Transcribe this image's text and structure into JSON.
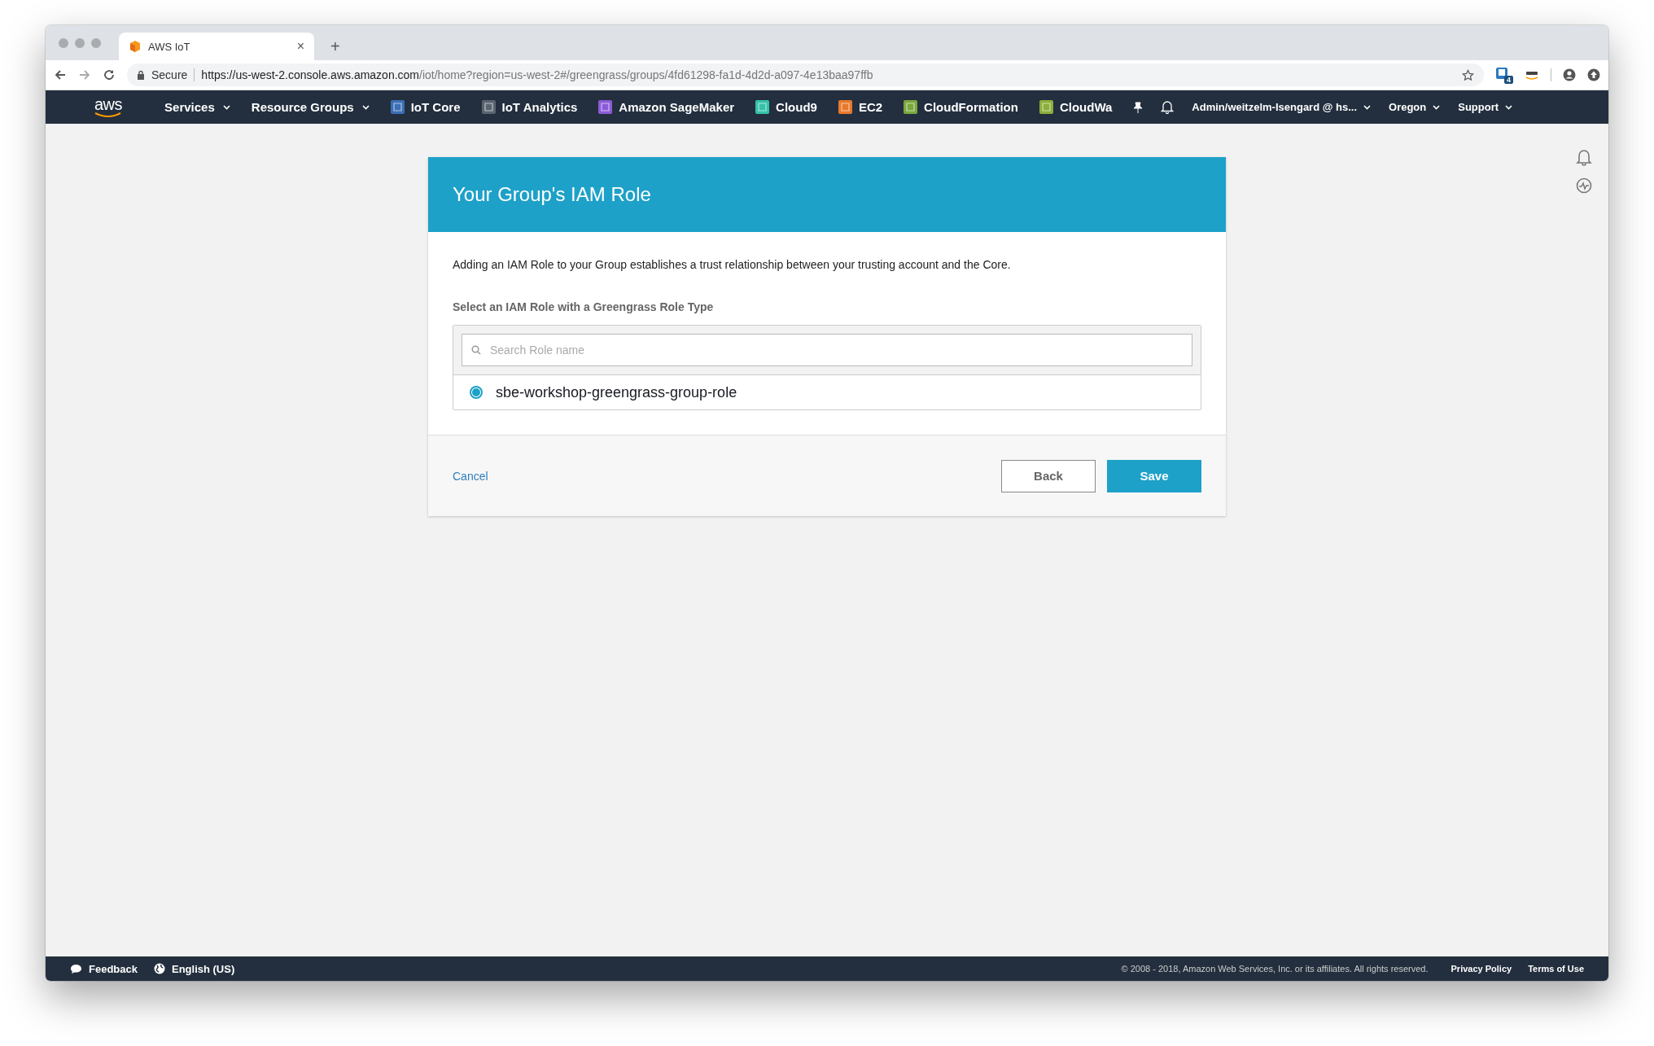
{
  "browser": {
    "tab": {
      "title": "AWS IoT",
      "close": "×",
      "new_tab": "+"
    },
    "address": {
      "secure": "Secure",
      "url_host": "https://us-west-2.console.aws.amazon.com",
      "url_path": "/iot/home?region=us-west-2#/greengrass/groups/4fd61298-fa1d-4d2d-a097-4e13baa97ffb"
    },
    "extension_badge": "4"
  },
  "nav": {
    "logo": "aws",
    "menus": [
      {
        "label": "Services"
      },
      {
        "label": "Resource Groups"
      }
    ],
    "shortcuts": [
      {
        "label": "IoT Core",
        "color": "#3b6fb6"
      },
      {
        "label": "IoT Analytics",
        "color": "#5a6470"
      },
      {
        "label": "Amazon SageMaker",
        "color": "#8c5bd8"
      },
      {
        "label": "Cloud9",
        "color": "#35c2a8"
      },
      {
        "label": "EC2",
        "color": "#e8792b"
      },
      {
        "label": "CloudFormation",
        "color": "#7aa83c"
      },
      {
        "label": "CloudWa",
        "color": "#8cae3a"
      }
    ],
    "account": "Admin/weitzelm-Isengard @ hs...",
    "region": "Oregon",
    "support": "Support"
  },
  "card": {
    "title": "Your Group's IAM Role",
    "description": "Adding an IAM Role to your Group establishes a trust relationship between your trusting account and the Core.",
    "label": "Select an IAM Role with a Greengrass Role Type",
    "search": {
      "placeholder": "Search Role name"
    },
    "roles": [
      {
        "name": "sbe-workshop-greengrass-group-role",
        "selected": true
      }
    ],
    "cancel": "Cancel",
    "back": "Back",
    "save": "Save"
  },
  "footer": {
    "feedback": "Feedback",
    "language": "English (US)",
    "copyright": "© 2008 - 2018, Amazon Web Services, Inc. or its affiliates. All rights reserved.",
    "privacy": "Privacy Policy",
    "terms": "Terms of Use"
  }
}
